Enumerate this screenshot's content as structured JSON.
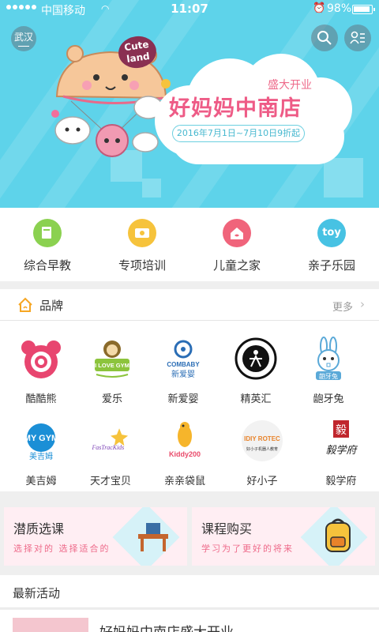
{
  "status_bar": {
    "carrier": "中国移动",
    "time": "11:07",
    "battery": "98%"
  },
  "header": {
    "city": "武汉"
  },
  "banner": {
    "sticker": "Cute land",
    "subtitle": "盛大开业",
    "title": "好妈妈中南店",
    "date_text": "2016年7月1日~7月10日9折起"
  },
  "categories": [
    {
      "label": "综合早教",
      "color": "#8bd150",
      "icon": "book-icon"
    },
    {
      "label": "专项培训",
      "color": "#f6c33c",
      "icon": "ribbon-icon"
    },
    {
      "label": "儿童之家",
      "color": "#f0647b",
      "icon": "house-icon"
    },
    {
      "label": "亲子乐园",
      "color": "#47c2e3",
      "icon": "toy-icon",
      "text": "toy"
    }
  ],
  "brands_section": {
    "title": "品牌",
    "more": "更多",
    "items": [
      {
        "name": "酷酷熊",
        "logo": "pink-bear-logo"
      },
      {
        "name": "爱乐",
        "logo": "i-love-gym-logo",
        "logo_text": "I LOVE GYM"
      },
      {
        "name": "新爱婴",
        "logo": "combaby-logo",
        "logo_text": "COMBABY",
        "logo_sub": "新爱婴"
      },
      {
        "name": "精英汇",
        "logo": "taekwondo-logo"
      },
      {
        "name": "龅牙兔",
        "logo": "rabbit-logo",
        "logo_text": "龅牙兔"
      },
      {
        "name": "美吉姆",
        "logo": "my-gym-logo",
        "logo_text": "MY GYM",
        "logo_sub": "美吉姆"
      },
      {
        "name": "天才宝贝",
        "logo": "fastrackids-logo",
        "logo_text": "FasTracKids"
      },
      {
        "name": "亲亲袋鼠",
        "logo": "kiddy-logo",
        "logo_text": "Kiddy200"
      },
      {
        "name": "好小子",
        "logo": "diy-robot-logo",
        "logo_text": "IDIY ROTEC",
        "logo_sub": "好小子机器人教育"
      },
      {
        "name": "毅学府",
        "logo": "yixuefu-logo",
        "logo_text": "毅学府"
      }
    ]
  },
  "promos": [
    {
      "title": "潜质选课",
      "subtitle": "选择对的 选择适合的"
    },
    {
      "title": "课程购买",
      "subtitle": "学习为了更好的将来"
    }
  ],
  "news": {
    "title": "最新活动",
    "items": [
      {
        "title": "好妈妈中南店盛大开业"
      }
    ]
  },
  "colors": {
    "banner_bg": "#5ed3ea",
    "accent_pink": "#ee5b86",
    "page_bg": "#efefef"
  }
}
